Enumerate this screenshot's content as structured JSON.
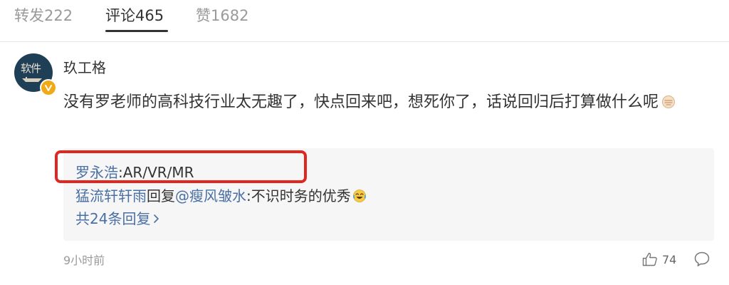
{
  "tabs": {
    "repost": "转发222",
    "comment": "评论465",
    "like": "赞1682"
  },
  "comment": {
    "username": "玖工格",
    "avatar_text": "软件",
    "text": "没有罗老师的高科技行业太无趣了，快点回来吧，想死你了，话说回归后打算做什么呢",
    "emoji": "fist-emoji-icon"
  },
  "replies": {
    "reply1_author": "罗永浩",
    "reply1_sep": ":",
    "reply1_text": "AR/VR/MR",
    "reply2_author": "猛流轩轩雨",
    "reply2_mid": "回复",
    "reply2_mention": "@瘦风皱水",
    "reply2_sep": ":",
    "reply2_text": "不识时务的优秀",
    "reply2_emoji": "laugh-cry-emoji-icon",
    "more_label": "共24条回复"
  },
  "footer": {
    "timestamp": "9小时前",
    "like_count": "74"
  },
  "colors": {
    "link": "#4a6fa5",
    "highlight": "#e0261f",
    "muted": "#9a9a9a",
    "verified": "#f2a916"
  }
}
